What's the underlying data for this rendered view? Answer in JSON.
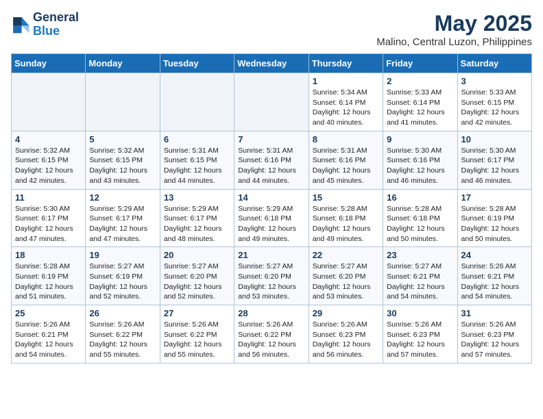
{
  "logo": {
    "line1": "General",
    "line2": "Blue"
  },
  "title": "May 2025",
  "location": "Malino, Central Luzon, Philippines",
  "weekdays": [
    "Sunday",
    "Monday",
    "Tuesday",
    "Wednesday",
    "Thursday",
    "Friday",
    "Saturday"
  ],
  "weeks": [
    [
      {
        "day": "",
        "text": ""
      },
      {
        "day": "",
        "text": ""
      },
      {
        "day": "",
        "text": ""
      },
      {
        "day": "",
        "text": ""
      },
      {
        "day": "1",
        "text": "Sunrise: 5:34 AM\nSunset: 6:14 PM\nDaylight: 12 hours\nand 40 minutes."
      },
      {
        "day": "2",
        "text": "Sunrise: 5:33 AM\nSunset: 6:14 PM\nDaylight: 12 hours\nand 41 minutes."
      },
      {
        "day": "3",
        "text": "Sunrise: 5:33 AM\nSunset: 6:15 PM\nDaylight: 12 hours\nand 42 minutes."
      }
    ],
    [
      {
        "day": "4",
        "text": "Sunrise: 5:32 AM\nSunset: 6:15 PM\nDaylight: 12 hours\nand 42 minutes."
      },
      {
        "day": "5",
        "text": "Sunrise: 5:32 AM\nSunset: 6:15 PM\nDaylight: 12 hours\nand 43 minutes."
      },
      {
        "day": "6",
        "text": "Sunrise: 5:31 AM\nSunset: 6:15 PM\nDaylight: 12 hours\nand 44 minutes."
      },
      {
        "day": "7",
        "text": "Sunrise: 5:31 AM\nSunset: 6:16 PM\nDaylight: 12 hours\nand 44 minutes."
      },
      {
        "day": "8",
        "text": "Sunrise: 5:31 AM\nSunset: 6:16 PM\nDaylight: 12 hours\nand 45 minutes."
      },
      {
        "day": "9",
        "text": "Sunrise: 5:30 AM\nSunset: 6:16 PM\nDaylight: 12 hours\nand 46 minutes."
      },
      {
        "day": "10",
        "text": "Sunrise: 5:30 AM\nSunset: 6:17 PM\nDaylight: 12 hours\nand 46 minutes."
      }
    ],
    [
      {
        "day": "11",
        "text": "Sunrise: 5:30 AM\nSunset: 6:17 PM\nDaylight: 12 hours\nand 47 minutes."
      },
      {
        "day": "12",
        "text": "Sunrise: 5:29 AM\nSunset: 6:17 PM\nDaylight: 12 hours\nand 47 minutes."
      },
      {
        "day": "13",
        "text": "Sunrise: 5:29 AM\nSunset: 6:17 PM\nDaylight: 12 hours\nand 48 minutes."
      },
      {
        "day": "14",
        "text": "Sunrise: 5:29 AM\nSunset: 6:18 PM\nDaylight: 12 hours\nand 49 minutes."
      },
      {
        "day": "15",
        "text": "Sunrise: 5:28 AM\nSunset: 6:18 PM\nDaylight: 12 hours\nand 49 minutes."
      },
      {
        "day": "16",
        "text": "Sunrise: 5:28 AM\nSunset: 6:18 PM\nDaylight: 12 hours\nand 50 minutes."
      },
      {
        "day": "17",
        "text": "Sunrise: 5:28 AM\nSunset: 6:19 PM\nDaylight: 12 hours\nand 50 minutes."
      }
    ],
    [
      {
        "day": "18",
        "text": "Sunrise: 5:28 AM\nSunset: 6:19 PM\nDaylight: 12 hours\nand 51 minutes."
      },
      {
        "day": "19",
        "text": "Sunrise: 5:27 AM\nSunset: 6:19 PM\nDaylight: 12 hours\nand 52 minutes."
      },
      {
        "day": "20",
        "text": "Sunrise: 5:27 AM\nSunset: 6:20 PM\nDaylight: 12 hours\nand 52 minutes."
      },
      {
        "day": "21",
        "text": "Sunrise: 5:27 AM\nSunset: 6:20 PM\nDaylight: 12 hours\nand 53 minutes."
      },
      {
        "day": "22",
        "text": "Sunrise: 5:27 AM\nSunset: 6:20 PM\nDaylight: 12 hours\nand 53 minutes."
      },
      {
        "day": "23",
        "text": "Sunrise: 5:27 AM\nSunset: 6:21 PM\nDaylight: 12 hours\nand 54 minutes."
      },
      {
        "day": "24",
        "text": "Sunrise: 5:26 AM\nSunset: 6:21 PM\nDaylight: 12 hours\nand 54 minutes."
      }
    ],
    [
      {
        "day": "25",
        "text": "Sunrise: 5:26 AM\nSunset: 6:21 PM\nDaylight: 12 hours\nand 54 minutes."
      },
      {
        "day": "26",
        "text": "Sunrise: 5:26 AM\nSunset: 6:22 PM\nDaylight: 12 hours\nand 55 minutes."
      },
      {
        "day": "27",
        "text": "Sunrise: 5:26 AM\nSunset: 6:22 PM\nDaylight: 12 hours\nand 55 minutes."
      },
      {
        "day": "28",
        "text": "Sunrise: 5:26 AM\nSunset: 6:22 PM\nDaylight: 12 hours\nand 56 minutes."
      },
      {
        "day": "29",
        "text": "Sunrise: 5:26 AM\nSunset: 6:23 PM\nDaylight: 12 hours\nand 56 minutes."
      },
      {
        "day": "30",
        "text": "Sunrise: 5:26 AM\nSunset: 6:23 PM\nDaylight: 12 hours\nand 57 minutes."
      },
      {
        "day": "31",
        "text": "Sunrise: 5:26 AM\nSunset: 6:23 PM\nDaylight: 12 hours\nand 57 minutes."
      }
    ]
  ]
}
